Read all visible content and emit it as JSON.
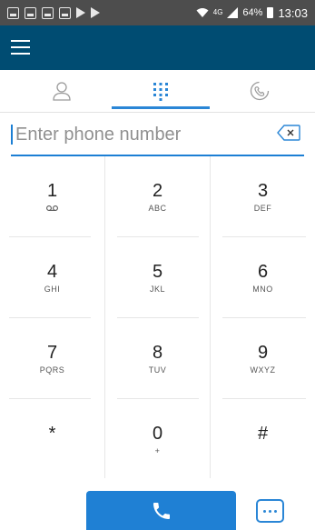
{
  "status_bar": {
    "network": "4G",
    "battery": "64%",
    "time": "13:03"
  },
  "tabs": [
    {
      "name": "contacts",
      "icon": "person-icon",
      "active": false
    },
    {
      "name": "keypad",
      "icon": "dialpad-icon",
      "active": true
    },
    {
      "name": "history",
      "icon": "call-history-icon",
      "active": false
    }
  ],
  "input": {
    "value": "",
    "placeholder": "Enter phone number"
  },
  "keypad": {
    "keys": [
      {
        "digit": "1",
        "letters": ""
      },
      {
        "digit": "2",
        "letters": "ABC"
      },
      {
        "digit": "3",
        "letters": "DEF"
      },
      {
        "digit": "4",
        "letters": "GHI"
      },
      {
        "digit": "5",
        "letters": "JKL"
      },
      {
        "digit": "6",
        "letters": "MNO"
      },
      {
        "digit": "7",
        "letters": "PQRS"
      },
      {
        "digit": "8",
        "letters": "TUV"
      },
      {
        "digit": "9",
        "letters": "WXYZ"
      },
      {
        "digit": "*",
        "letters": ""
      },
      {
        "digit": "0",
        "letters": "+"
      },
      {
        "digit": "#",
        "letters": ""
      }
    ]
  },
  "colors": {
    "app_bar": "#004c72",
    "accent": "#1f80d4",
    "status_bar": "#4d4d4d"
  }
}
